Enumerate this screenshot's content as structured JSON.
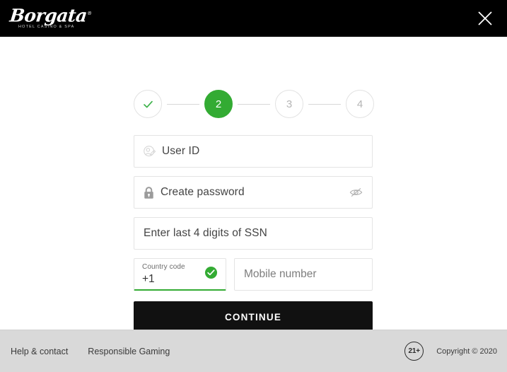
{
  "header": {
    "logo": {
      "name": "Borgata",
      "registered": "®",
      "tagline": "HOTEL   CASINO & SPA"
    },
    "close_label": "×",
    "background": "#000000"
  },
  "stepper": {
    "steps": [
      {
        "id": "step-1",
        "label": "✓",
        "state": "done"
      },
      {
        "id": "step-2",
        "label": "2",
        "state": "active"
      },
      {
        "id": "step-3",
        "label": "3",
        "state": "todo"
      },
      {
        "id": "step-4",
        "label": "4",
        "state": "todo"
      }
    ],
    "active_color": "#33ab33",
    "inactive_color": "#b5b5b5"
  },
  "form": {
    "user_id": {
      "placeholder": "User ID",
      "icon": "user-id-icon"
    },
    "password": {
      "placeholder": "Create password",
      "icon": "lock-icon",
      "toggle_icon": "eye-slash-icon",
      "visible": false
    },
    "ssn": {
      "placeholder": "Enter last 4 digits of SSN"
    },
    "country_code": {
      "label": "Country code",
      "value": "+1",
      "valid": true,
      "valid_icon": "check-circle-icon",
      "valid_color": "#33ab33"
    },
    "mobile": {
      "placeholder": "Mobile number"
    },
    "submit_label": "CONTINUE"
  },
  "footer": {
    "links": [
      {
        "label": "Help & contact"
      },
      {
        "label": "Responsible Gaming"
      }
    ],
    "age_badge": "21+",
    "copyright": "Copyright © 2020",
    "background": "#d9d9d9"
  }
}
